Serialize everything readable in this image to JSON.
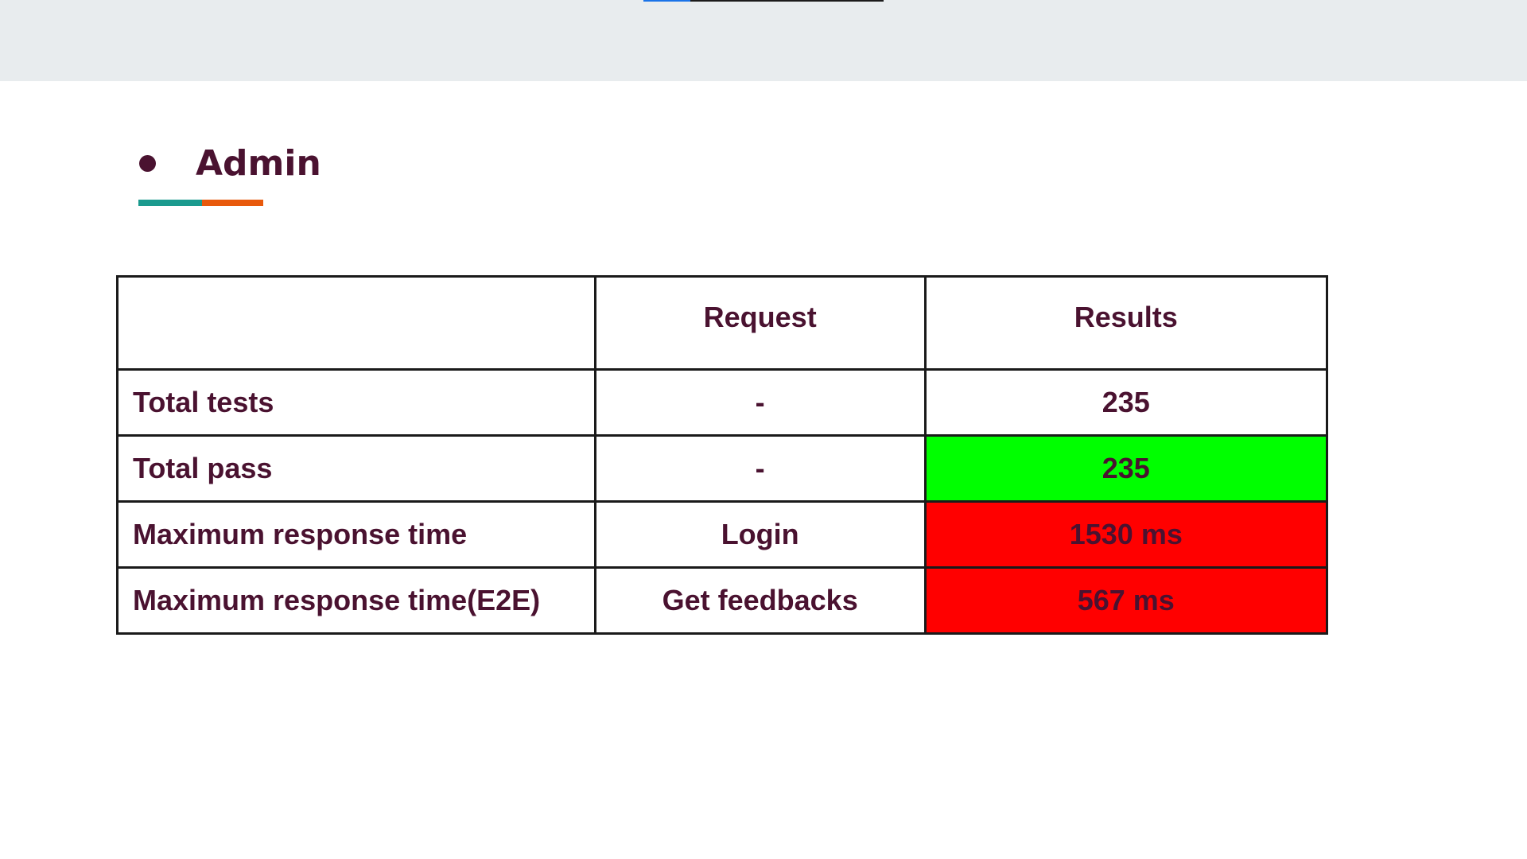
{
  "slide": {
    "heading": "Admin",
    "colors": {
      "top_bar": "#e8ecee",
      "text": "#4a1230",
      "underline_teal": "#1a9a8e",
      "underline_orange": "#e8590c",
      "pass": "#00ff00",
      "fail": "#ff0000"
    }
  },
  "table": {
    "headers": [
      "",
      "Request",
      "Results"
    ],
    "rows": [
      {
        "label": "Total tests",
        "request": "-",
        "result": "235",
        "status": "neutral"
      },
      {
        "label": "Total pass",
        "request": "-",
        "result": "235",
        "status": "pass"
      },
      {
        "label": "Maximum response time",
        "request": "Login",
        "result": "1530 ms",
        "status": "fail"
      },
      {
        "label": "Maximum response time(E2E)",
        "request": "Get feedbacks",
        "result": "567 ms",
        "status": "fail"
      }
    ]
  }
}
